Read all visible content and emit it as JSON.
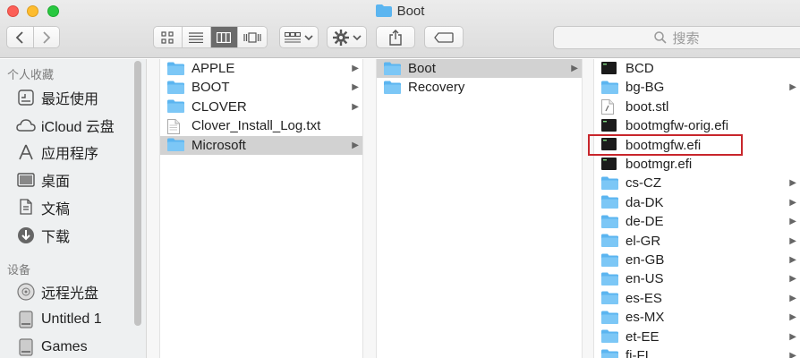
{
  "window": {
    "title": "Boot"
  },
  "toolbar": {
    "search_placeholder": "搜索"
  },
  "sidebar": {
    "favorites_header": "个人收藏",
    "favorites": [
      {
        "label": "最近使用",
        "icon": "recents-icon"
      },
      {
        "label": "iCloud 云盘",
        "icon": "cloud-icon"
      },
      {
        "label": "应用程序",
        "icon": "applications-icon"
      },
      {
        "label": "桌面",
        "icon": "desktop-icon"
      },
      {
        "label": "文稿",
        "icon": "documents-icon"
      },
      {
        "label": "下载",
        "icon": "downloads-icon"
      }
    ],
    "devices_header": "设备",
    "devices": [
      {
        "label": "远程光盘",
        "icon": "disc-icon"
      },
      {
        "label": "Untitled 1",
        "icon": "drive-icon"
      },
      {
        "label": "Games",
        "icon": "drive-icon"
      }
    ]
  },
  "columns": [
    {
      "items": [
        {
          "name": "APPLE",
          "type": "folder",
          "has_children": true
        },
        {
          "name": "BOOT",
          "type": "folder",
          "has_children": true
        },
        {
          "name": "CLOVER",
          "type": "folder",
          "has_children": true
        },
        {
          "name": "Clover_Install_Log.txt",
          "type": "text",
          "has_children": false
        },
        {
          "name": "Microsoft",
          "type": "folder",
          "has_children": true,
          "selected": true
        }
      ]
    },
    {
      "items": [
        {
          "name": "Boot",
          "type": "folder",
          "has_children": true,
          "selected": true
        },
        {
          "name": "Recovery",
          "type": "folder",
          "has_children": false
        }
      ]
    },
    {
      "items": [
        {
          "name": "BCD",
          "type": "exec",
          "has_children": false
        },
        {
          "name": "bg-BG",
          "type": "folder",
          "has_children": true
        },
        {
          "name": "boot.stl",
          "type": "doc",
          "has_children": false
        },
        {
          "name": "bootmgfw-orig.efi",
          "type": "exec",
          "has_children": false
        },
        {
          "name": "bootmgfw.efi",
          "type": "exec",
          "has_children": false,
          "highlighted": true
        },
        {
          "name": "bootmgr.efi",
          "type": "exec",
          "has_children": false
        },
        {
          "name": "cs-CZ",
          "type": "folder",
          "has_children": true
        },
        {
          "name": "da-DK",
          "type": "folder",
          "has_children": true
        },
        {
          "name": "de-DE",
          "type": "folder",
          "has_children": true
        },
        {
          "name": "el-GR",
          "type": "folder",
          "has_children": true
        },
        {
          "name": "en-GB",
          "type": "folder",
          "has_children": true
        },
        {
          "name": "en-US",
          "type": "folder",
          "has_children": true
        },
        {
          "name": "es-ES",
          "type": "folder",
          "has_children": true
        },
        {
          "name": "es-MX",
          "type": "folder",
          "has_children": true
        },
        {
          "name": "et-EE",
          "type": "folder",
          "has_children": true
        },
        {
          "name": "fi-FI",
          "type": "folder",
          "has_children": true
        }
      ]
    }
  ],
  "colors": {
    "folder": "#5bb5f0",
    "selection": "#d2d2d2",
    "highlight_border": "#c8262c"
  }
}
